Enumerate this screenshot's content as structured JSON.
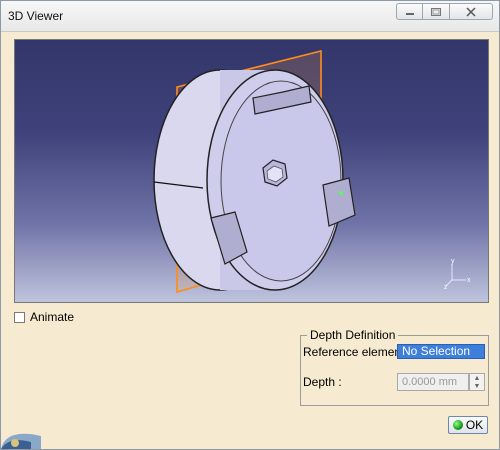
{
  "window": {
    "title": "3D Viewer",
    "minimize_icon": "minimize-icon",
    "maximize_icon": "maximize-icon",
    "close_icon": "close-icon"
  },
  "viewport": {
    "description": "3D model viewer",
    "axis_labels": {
      "x": "x",
      "y": "y",
      "z": "z"
    }
  },
  "animate": {
    "label": "Animate",
    "checked": false
  },
  "depth_definition": {
    "group_title": "Depth Definition",
    "reference_label": "Reference element :",
    "reference_value": "No Selection",
    "depth_label": "Depth :",
    "depth_value": "0.0000 mm"
  },
  "buttons": {
    "ok_label": "OK"
  },
  "colors": {
    "viewport_top": "#33366a",
    "viewport_bottom": "#bfc4dd",
    "plane": "#ff8c1a",
    "selection": "#3f7fdc",
    "dialog_bg": "#f6ead0"
  }
}
